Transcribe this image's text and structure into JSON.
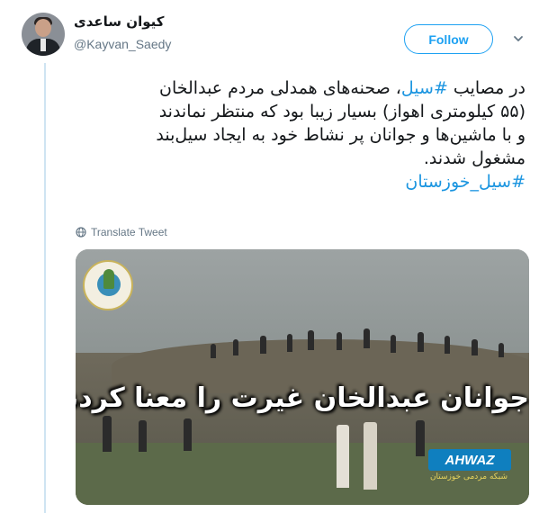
{
  "author": {
    "name": "کیوان ساعدی",
    "handle": "@Kayvan_Saedy"
  },
  "actions": {
    "follow_label": "Follow"
  },
  "tweet": {
    "lines": [
      {
        "parts": [
          {
            "text": "در مصایب ",
            "link": false
          },
          {
            "text": "#سیل",
            "link": true
          },
          {
            "text": "، صحنه‌های همدلی مردم عبدالخان",
            "link": false
          }
        ]
      },
      {
        "parts": [
          {
            "text": "(۵۵ کیلومتری اهواز) بسیار زیبا بود که منتظر نماندند",
            "link": false
          }
        ]
      },
      {
        "parts": [
          {
            "text": "و با ماشین‌ها و جوانان پر نشاط خود به ایجاد سیل‌بند",
            "link": false
          }
        ]
      },
      {
        "parts": [
          {
            "text": "مشغول شدند.",
            "link": false
          }
        ]
      },
      {
        "parts": [
          {
            "text": "#سیل_خوزستان",
            "link": true
          }
        ]
      }
    ],
    "translate_label": "Translate Tweet"
  },
  "media": {
    "caption": "جوانان عبدالخان غیرت را معنا کردند",
    "watermark_brand": "AHWAZ",
    "watermark_sub": "شبکه مردمی خوزستان"
  },
  "colors": {
    "accent": "#1da1f2",
    "link": "#1b95e0",
    "secondary_text": "#657786",
    "thread_line": "#cfe4f2"
  },
  "icons": {
    "translate": "globe-icon",
    "menu": "chevron-down-icon"
  }
}
